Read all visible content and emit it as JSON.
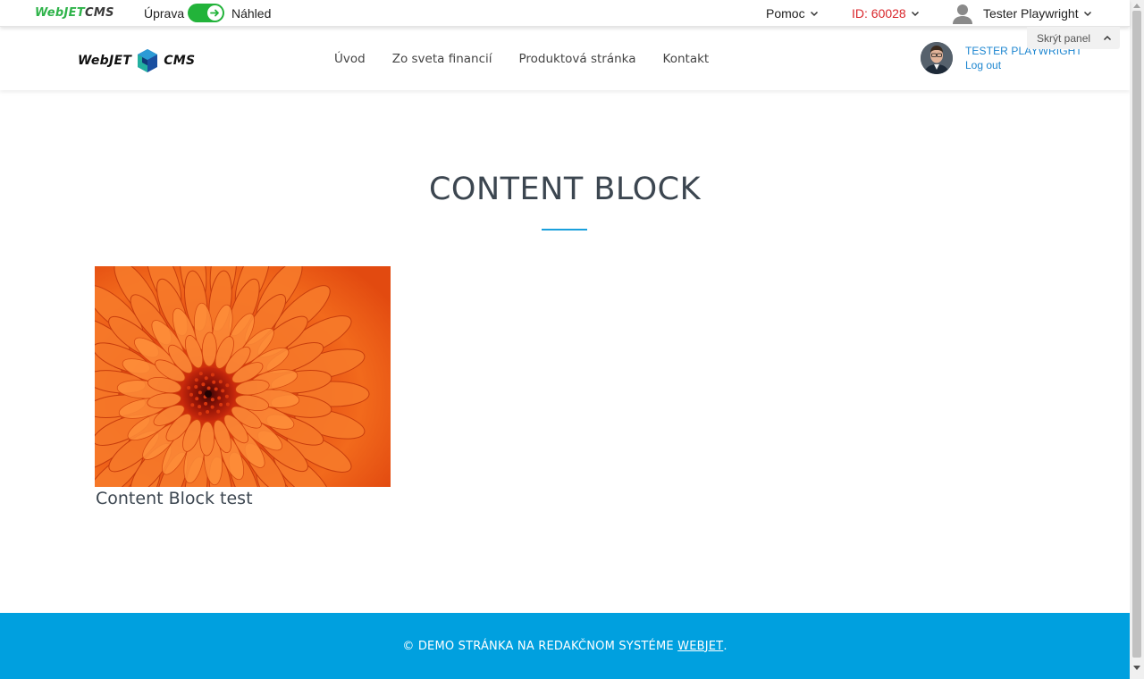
{
  "admin_bar": {
    "logo": {
      "part1": "WebJET",
      "part2": "CMS"
    },
    "mode_edit": "Úprava",
    "mode_preview": "Náhled",
    "help": "Pomoc",
    "page_id": "ID: 60028",
    "user": "Tester Playwright",
    "hide_panel": "Skrýt panel"
  },
  "header": {
    "logo": {
      "part1": "WebJET",
      "part2": "CMS"
    },
    "nav": [
      "Úvod",
      "Zo sveta financií",
      "Produktová stránka",
      "Kontakt"
    ],
    "user_name": "TESTER PLAYWRIGHT",
    "logout": "Log out"
  },
  "content": {
    "title": "CONTENT BLOCK",
    "caption": "Content Block test"
  },
  "footer": {
    "text": "© DEMO STRÁNKA NA REDAKČNOM SYSTÉME ",
    "link": "WEBJET",
    "suffix": "."
  },
  "colors": {
    "accent": "#00a0df",
    "toggle_on": "#22b33a",
    "id_red": "#d9262b",
    "link_blue": "#1d86d0"
  }
}
